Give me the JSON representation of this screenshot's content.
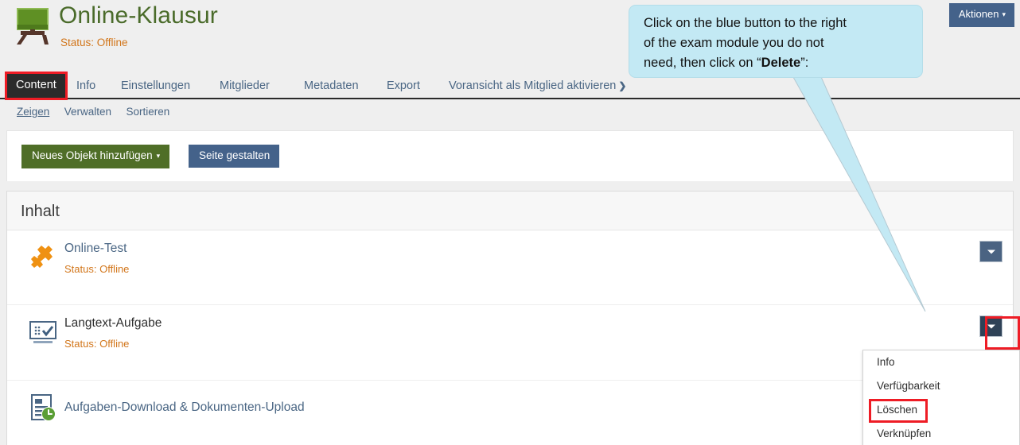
{
  "header": {
    "icon": "chalkboard-icon",
    "title": "Online-Klausur",
    "status": "Status: Offline",
    "actions_label": "Aktionen",
    "actions_caret": "▾"
  },
  "tabs": [
    {
      "label": "Content",
      "active": true
    },
    {
      "label": "Info",
      "active": false
    },
    {
      "label": "Einstellungen",
      "active": false
    },
    {
      "label": "Mitglieder",
      "active": false
    },
    {
      "label": "Metadaten",
      "active": false
    },
    {
      "label": "Export",
      "active": false
    },
    {
      "label": "Voransicht als Mitglied aktivieren",
      "active": false,
      "chevron": "❯"
    }
  ],
  "subnav": [
    {
      "label": "Zeigen",
      "active": true
    },
    {
      "label": "Verwalten",
      "active": false
    },
    {
      "label": "Sortieren",
      "active": false
    }
  ],
  "toolbar": {
    "add_object_label": "Neues Objekt hinzufügen",
    "add_object_caret": "▾",
    "design_page_label": "Seite gestalten"
  },
  "content": {
    "section_title": "Inhalt",
    "items": [
      {
        "icon": "puzzle-piece-icon",
        "title": "Online-Test",
        "status": "Status: Offline",
        "link": true,
        "dropdown": "chevron-down-icon",
        "dropdown_active": false
      },
      {
        "icon": "exercise-screen-check-icon",
        "title": "Langtext-Aufgabe",
        "status": "Status: Offline",
        "link": false,
        "dropdown": "chevron-down-icon",
        "dropdown_active": true
      },
      {
        "icon": "document-clock-icon",
        "title": "Aufgaben-Download & Dokumenten-Upload",
        "status": "",
        "link": true,
        "dropdown": null,
        "dropdown_active": false
      }
    ]
  },
  "dropdown_menu": {
    "items": [
      {
        "label": "Info",
        "highlighted": false
      },
      {
        "label": "Verfügbarkeit",
        "highlighted": false
      },
      {
        "label": "Löschen",
        "highlighted": true
      },
      {
        "label": "Verknüpfen",
        "highlighted": false
      }
    ]
  },
  "callout": {
    "line1": "Click on the blue button to the right",
    "line2": "of the exam module you do not",
    "line3_pre": "need, then click on “",
    "line3_bold": "Delete",
    "line3_post": "”:"
  },
  "colors": {
    "accent_blue": "#44628a",
    "accent_green": "#4f6e27",
    "status_orange": "#d2761b",
    "highlight_red": "#ee1c25",
    "callout_bg": "#c3e9f4",
    "title_green": "#4a6b2a"
  }
}
